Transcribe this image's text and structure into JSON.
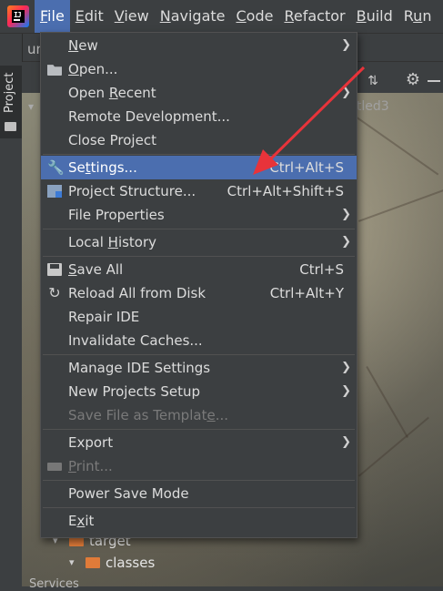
{
  "menubar": {
    "items": [
      {
        "label_pre": "",
        "mnemonic": "F",
        "label_post": "ile",
        "active": true
      },
      {
        "label_pre": "",
        "mnemonic": "E",
        "label_post": "dit",
        "active": false
      },
      {
        "label_pre": "",
        "mnemonic": "V",
        "label_post": "iew",
        "active": false
      },
      {
        "label_pre": "",
        "mnemonic": "N",
        "label_post": "avigate",
        "active": false
      },
      {
        "label_pre": "",
        "mnemonic": "C",
        "label_post": "ode",
        "active": false
      },
      {
        "label_pre": "",
        "mnemonic": "R",
        "label_post": "efactor",
        "active": false
      },
      {
        "label_pre": "",
        "mnemonic": "B",
        "label_post": "uild",
        "active": false
      },
      {
        "label_pre": "R",
        "mnemonic": "u",
        "label_post": "n",
        "active": false
      }
    ]
  },
  "background": {
    "project_tab_label": "Project",
    "editor_tab_partial": "un",
    "editor_tab_title_partial": "itled3",
    "tree": [
      {
        "label": "target",
        "expanded": true
      },
      {
        "label": "classes",
        "expanded": true
      }
    ],
    "services_label_partial": "Services"
  },
  "file_menu": {
    "items": [
      {
        "type": "item",
        "pre": "",
        "mn": "N",
        "post": "ew",
        "shortcut": "",
        "submenu": true,
        "icon": "",
        "disabled": false,
        "selected": false
      },
      {
        "type": "item",
        "pre": "",
        "mn": "O",
        "post": "pen...",
        "shortcut": "",
        "submenu": false,
        "icon": "folder-open-icon",
        "disabled": false,
        "selected": false
      },
      {
        "type": "item",
        "pre": "Open ",
        "mn": "R",
        "post": "ecent",
        "shortcut": "",
        "submenu": true,
        "icon": "",
        "disabled": false,
        "selected": false
      },
      {
        "type": "item",
        "pre": "Remote Development...",
        "mn": "",
        "post": "",
        "shortcut": "",
        "submenu": false,
        "icon": "",
        "disabled": false,
        "selected": false
      },
      {
        "type": "item",
        "pre": "Close Project",
        "mn": "",
        "post": "",
        "shortcut": "",
        "submenu": false,
        "icon": "",
        "disabled": false,
        "selected": false
      },
      {
        "type": "sep"
      },
      {
        "type": "item",
        "pre": "Se",
        "mn": "t",
        "post": "tings...",
        "shortcut": "Ctrl+Alt+S",
        "submenu": false,
        "icon": "wrench-icon",
        "disabled": false,
        "selected": true
      },
      {
        "type": "item",
        "pre": "Project Structure...",
        "mn": "",
        "post": "",
        "shortcut": "Ctrl+Alt+Shift+S",
        "submenu": false,
        "icon": "project-structure-icon",
        "disabled": false,
        "selected": false
      },
      {
        "type": "item",
        "pre": "File Properties",
        "mn": "",
        "post": "",
        "shortcut": "",
        "submenu": true,
        "icon": "",
        "disabled": false,
        "selected": false
      },
      {
        "type": "sep"
      },
      {
        "type": "item",
        "pre": "Local ",
        "mn": "H",
        "post": "istory",
        "shortcut": "",
        "submenu": true,
        "icon": "",
        "disabled": false,
        "selected": false
      },
      {
        "type": "sep"
      },
      {
        "type": "item",
        "pre": "",
        "mn": "S",
        "post": "ave All",
        "shortcut": "Ctrl+S",
        "submenu": false,
        "icon": "save-icon",
        "disabled": false,
        "selected": false
      },
      {
        "type": "item",
        "pre": "Reload All from Disk",
        "mn": "",
        "post": "",
        "shortcut": "Ctrl+Alt+Y",
        "submenu": false,
        "icon": "reload-icon",
        "disabled": false,
        "selected": false
      },
      {
        "type": "item",
        "pre": "Repair IDE",
        "mn": "",
        "post": "",
        "shortcut": "",
        "submenu": false,
        "icon": "",
        "disabled": false,
        "selected": false
      },
      {
        "type": "item",
        "pre": "Invalidate Caches...",
        "mn": "",
        "post": "",
        "shortcut": "",
        "submenu": false,
        "icon": "",
        "disabled": false,
        "selected": false
      },
      {
        "type": "sep"
      },
      {
        "type": "item",
        "pre": "Manage IDE Settings",
        "mn": "",
        "post": "",
        "shortcut": "",
        "submenu": true,
        "icon": "",
        "disabled": false,
        "selected": false
      },
      {
        "type": "item",
        "pre": "New Projects Setup",
        "mn": "",
        "post": "",
        "shortcut": "",
        "submenu": true,
        "icon": "",
        "disabled": false,
        "selected": false
      },
      {
        "type": "item",
        "pre": "Save File as Templat",
        "mn": "e",
        "post": "...",
        "shortcut": "",
        "submenu": false,
        "icon": "",
        "disabled": true,
        "selected": false
      },
      {
        "type": "sep"
      },
      {
        "type": "item",
        "pre": "Export",
        "mn": "",
        "post": "",
        "shortcut": "",
        "submenu": true,
        "icon": "",
        "disabled": false,
        "selected": false
      },
      {
        "type": "item",
        "pre": "",
        "mn": "P",
        "post": "rint...",
        "shortcut": "",
        "submenu": false,
        "icon": "print-icon",
        "disabled": true,
        "selected": false
      },
      {
        "type": "sep"
      },
      {
        "type": "item",
        "pre": "Power Save Mode",
        "mn": "",
        "post": "",
        "shortcut": "",
        "submenu": false,
        "icon": "",
        "disabled": false,
        "selected": false
      },
      {
        "type": "sep"
      },
      {
        "type": "item",
        "pre": "E",
        "mn": "x",
        "post": "it",
        "shortcut": "",
        "submenu": false,
        "icon": "",
        "disabled": false,
        "selected": false
      }
    ]
  },
  "colors": {
    "menu_bg": "#3c3f41",
    "selection": "#4b6eaf",
    "annotation_arrow": "#e8333a"
  }
}
